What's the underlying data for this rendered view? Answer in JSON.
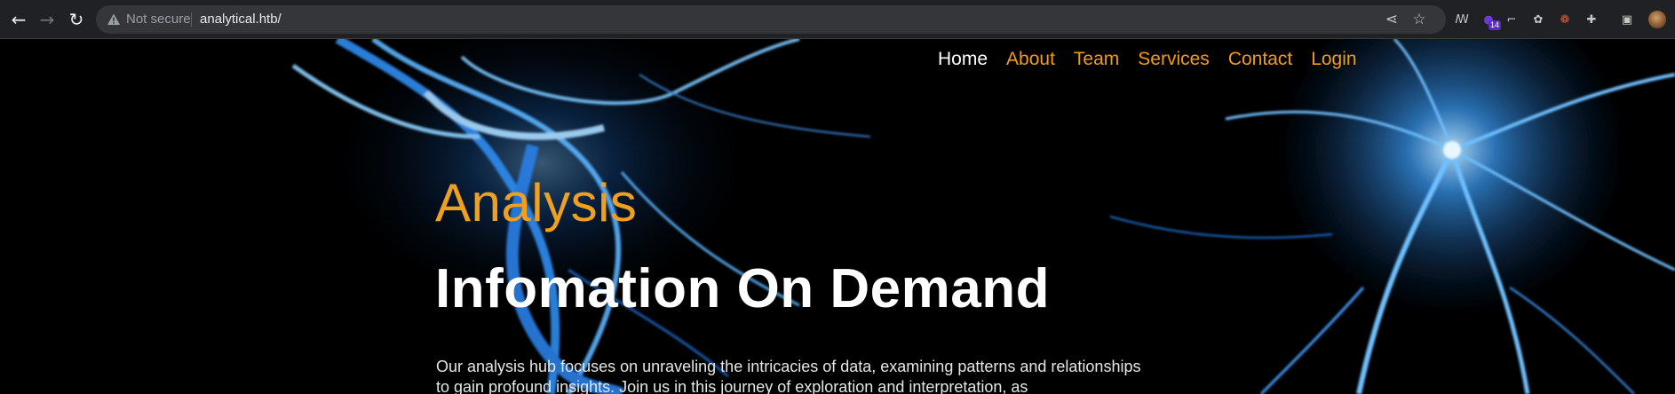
{
  "browser": {
    "security_label": "Not secure",
    "url": "analytical.htb/",
    "extensions": [
      {
        "name": "extension-1-icon",
        "glyph": "ꟿ"
      },
      {
        "name": "extension-2-icon",
        "glyph": "●",
        "badge": "14"
      },
      {
        "name": "extension-3-icon",
        "glyph": "⌐"
      },
      {
        "name": "extension-4-icon",
        "glyph": "✿"
      },
      {
        "name": "extension-5-icon",
        "glyph": "❁"
      },
      {
        "name": "puzzle-icon",
        "glyph": "✚"
      },
      {
        "name": "side-panel-icon",
        "glyph": "▣"
      }
    ]
  },
  "nav": {
    "items": [
      "Home",
      "About",
      "Team",
      "Services",
      "Contact",
      "Login"
    ],
    "active": "Home"
  },
  "hero": {
    "eyebrow": "Analysis",
    "headline": "Infomation On Demand",
    "paragraph": "Our analysis hub focuses on unraveling the intricacies of data, examining patterns and relationships to gain profound insights. Join us in this journey of exploration and interpretation, as"
  },
  "colors": {
    "accent": "#f39c12",
    "eyebrow": "#f0a020",
    "headline": "#ffffff",
    "chrome_bg": "#202124",
    "omnibox_bg": "#35363a",
    "glow": "#3aa0ff"
  }
}
